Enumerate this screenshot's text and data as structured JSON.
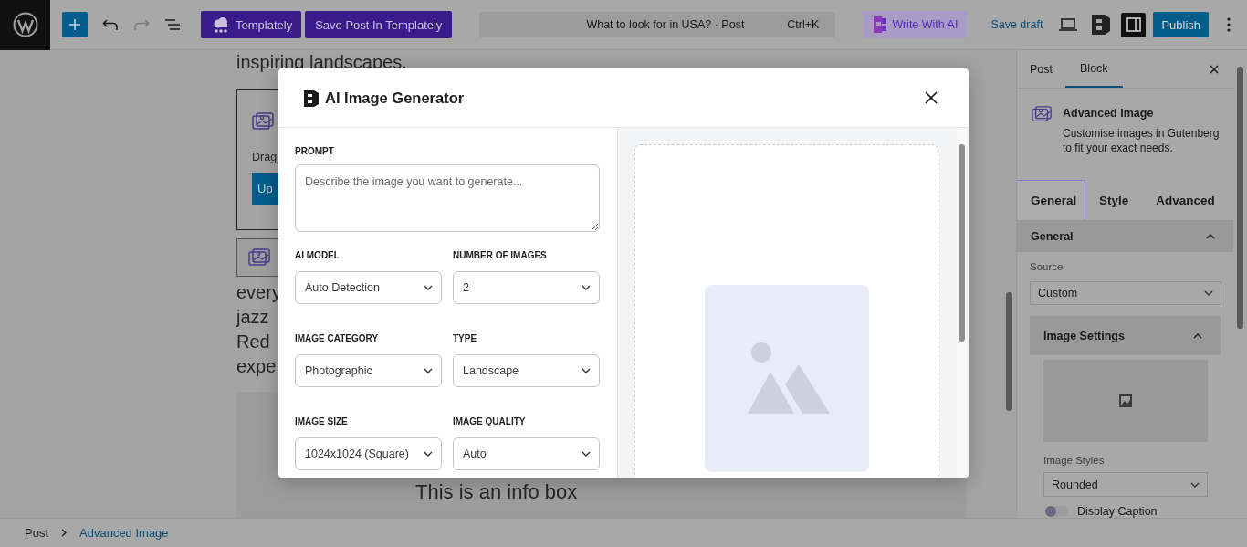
{
  "top_bar": {
    "templately_button": "Templately",
    "save_button": "Save Post In Templately",
    "redo_disabled": true,
    "command_bar": {
      "title": "What to look for in USA? · Post",
      "shortcut": "Ctrl+K"
    },
    "ai_button": "Write With AI",
    "save_draft": "Save draft",
    "sidebar_toggle_pressed": true,
    "publish": "Publish"
  },
  "editor": {
    "blocks": [
      {
        "kind": "paragraph",
        "text": "inspiring landscapes."
      },
      {
        "kind": "image_upload",
        "text": "Drag",
        "button": "Up"
      },
      {
        "kind": "image_placeholder"
      },
      {
        "kind": "lines",
        "lines": [
          "every",
          "jazz",
          "Red",
          "expe"
        ]
      },
      {
        "kind": "info_box",
        "title": "This is an info box"
      }
    ]
  },
  "modal": {
    "title": "AI Image Generator",
    "prompt": {
      "label": "PROMPT",
      "placeholder": "Describe the image you want to generate..."
    },
    "fields": [
      {
        "label": "AI MODEL",
        "value": "Auto Detection"
      },
      {
        "label": "NUMBER OF IMAGES",
        "value": "2"
      },
      {
        "label": "IMAGE CATEGORY",
        "value": "Photographic"
      },
      {
        "label": "TYPE",
        "value": "Landscape"
      },
      {
        "label": "IMAGE SIZE",
        "value": "1024x1024 (Square)"
      },
      {
        "label": "IMAGE QUALITY",
        "value": "Auto"
      }
    ]
  },
  "sidebar": {
    "tabs": [
      {
        "label": "Post",
        "selected": false
      },
      {
        "label": "Block",
        "selected": true
      }
    ],
    "block": {
      "title": "Advanced Image",
      "description": "Customise images in Gutenberg to fit your exact needs."
    },
    "inner_tabs": [
      {
        "label": "General",
        "selected": true
      },
      {
        "label": "Style",
        "selected": false
      },
      {
        "label": "Advanced",
        "selected": false
      }
    ],
    "panel": {
      "title": "General",
      "expanded": true,
      "source": {
        "label": "Source",
        "value": "Custom"
      },
      "subpanel": {
        "title": "Image Settings",
        "expanded": true,
        "styles": {
          "label": "Image Styles",
          "value": "Rounded"
        },
        "caption": {
          "label": "Display Caption",
          "on": false
        }
      }
    }
  },
  "breadcrumb": [
    "Post",
    "Advanced Image"
  ]
}
